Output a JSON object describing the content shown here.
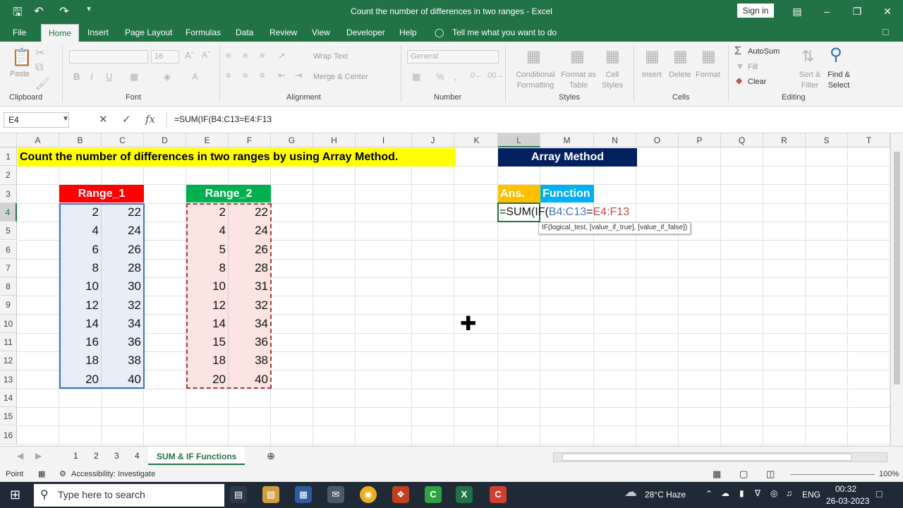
{
  "window": {
    "title": "Count the number of differences in two ranges  -  Excel",
    "sign_in": "Sign in"
  },
  "menu": [
    "File",
    "Home",
    "Insert",
    "Page Layout",
    "Formulas",
    "Data",
    "Review",
    "View",
    "Developer",
    "Help",
    "Tell me what you want to do"
  ],
  "ribbon": {
    "clipboard": {
      "label": "Clipboard",
      "paste": "Paste"
    },
    "font": {
      "label": "Font",
      "size": "16"
    },
    "alignment": {
      "label": "Alignment",
      "wrap": "Wrap Text",
      "merge": "Merge & Center"
    },
    "number": {
      "label": "Number",
      "format": "General"
    },
    "styles": {
      "label": "Styles",
      "conditional": "Conditional Formatting",
      "format_table": "Format as Table",
      "cell_styles": "Cell Styles"
    },
    "cells": {
      "label": "Cells",
      "insert": "Insert",
      "delete": "Delete",
      "format": "Format"
    },
    "editing": {
      "label": "Editing",
      "autosum": "AutoSum",
      "fill": "Fill",
      "clear": "Clear",
      "sort": "Sort & Filter",
      "find": "Find & Select"
    }
  },
  "formula_bar": {
    "name_box": "E4",
    "formula": "=SUM(IF(B4:C13=E4:F13"
  },
  "columns": [
    "A",
    "B",
    "C",
    "D",
    "E",
    "F",
    "G",
    "H",
    "I",
    "J",
    "K",
    "L",
    "M",
    "N",
    "O",
    "P",
    "Q",
    "R",
    "S",
    "T"
  ],
  "rows": [
    "1",
    "2",
    "3",
    "4",
    "5",
    "6",
    "7",
    "8",
    "9",
    "10",
    "11",
    "12",
    "13",
    "14",
    "15",
    "16"
  ],
  "sheet": {
    "banner": "Count the number of differences in two ranges by using Array Method.",
    "array_method": "Array Method",
    "range1_header": "Range_1",
    "range2_header": "Range_2",
    "ans_label": "Ans.",
    "function_label": "Function",
    "editing_prefix": "=SUM(IF(",
    "editing_ref1": "B4:C13",
    "editing_eq": "=",
    "editing_ref2": "E4:F13",
    "tooltip": "IF(logical_test, [value_if_true], [value_if_false])",
    "range1": [
      [
        2,
        22
      ],
      [
        4,
        24
      ],
      [
        6,
        26
      ],
      [
        8,
        28
      ],
      [
        10,
        30
      ],
      [
        12,
        32
      ],
      [
        14,
        34
      ],
      [
        16,
        36
      ],
      [
        18,
        38
      ],
      [
        20,
        40
      ]
    ],
    "range2": [
      [
        2,
        22
      ],
      [
        4,
        24
      ],
      [
        5,
        26
      ],
      [
        8,
        28
      ],
      [
        10,
        31
      ],
      [
        12,
        32
      ],
      [
        14,
        34
      ],
      [
        15,
        36
      ],
      [
        18,
        38
      ],
      [
        20,
        40
      ]
    ]
  },
  "tabs": [
    "1",
    "2",
    "3",
    "4",
    "SUM & IF Functions"
  ],
  "status": {
    "mode": "Point",
    "accessibility": "Accessibility: Investigate",
    "zoom": "100%"
  },
  "taskbar": {
    "search": "Type here to search",
    "weather": "28°C  Haze",
    "lang": "ENG",
    "time": "00:32",
    "date": "26-03-2023"
  },
  "colors": {
    "excel_green": "#217346",
    "banner_yellow": "#ffff00",
    "navy": "#002060",
    "red": "#ff0000",
    "green": "#00b050",
    "orange": "#ffc000",
    "cyan": "#00b0f0"
  }
}
